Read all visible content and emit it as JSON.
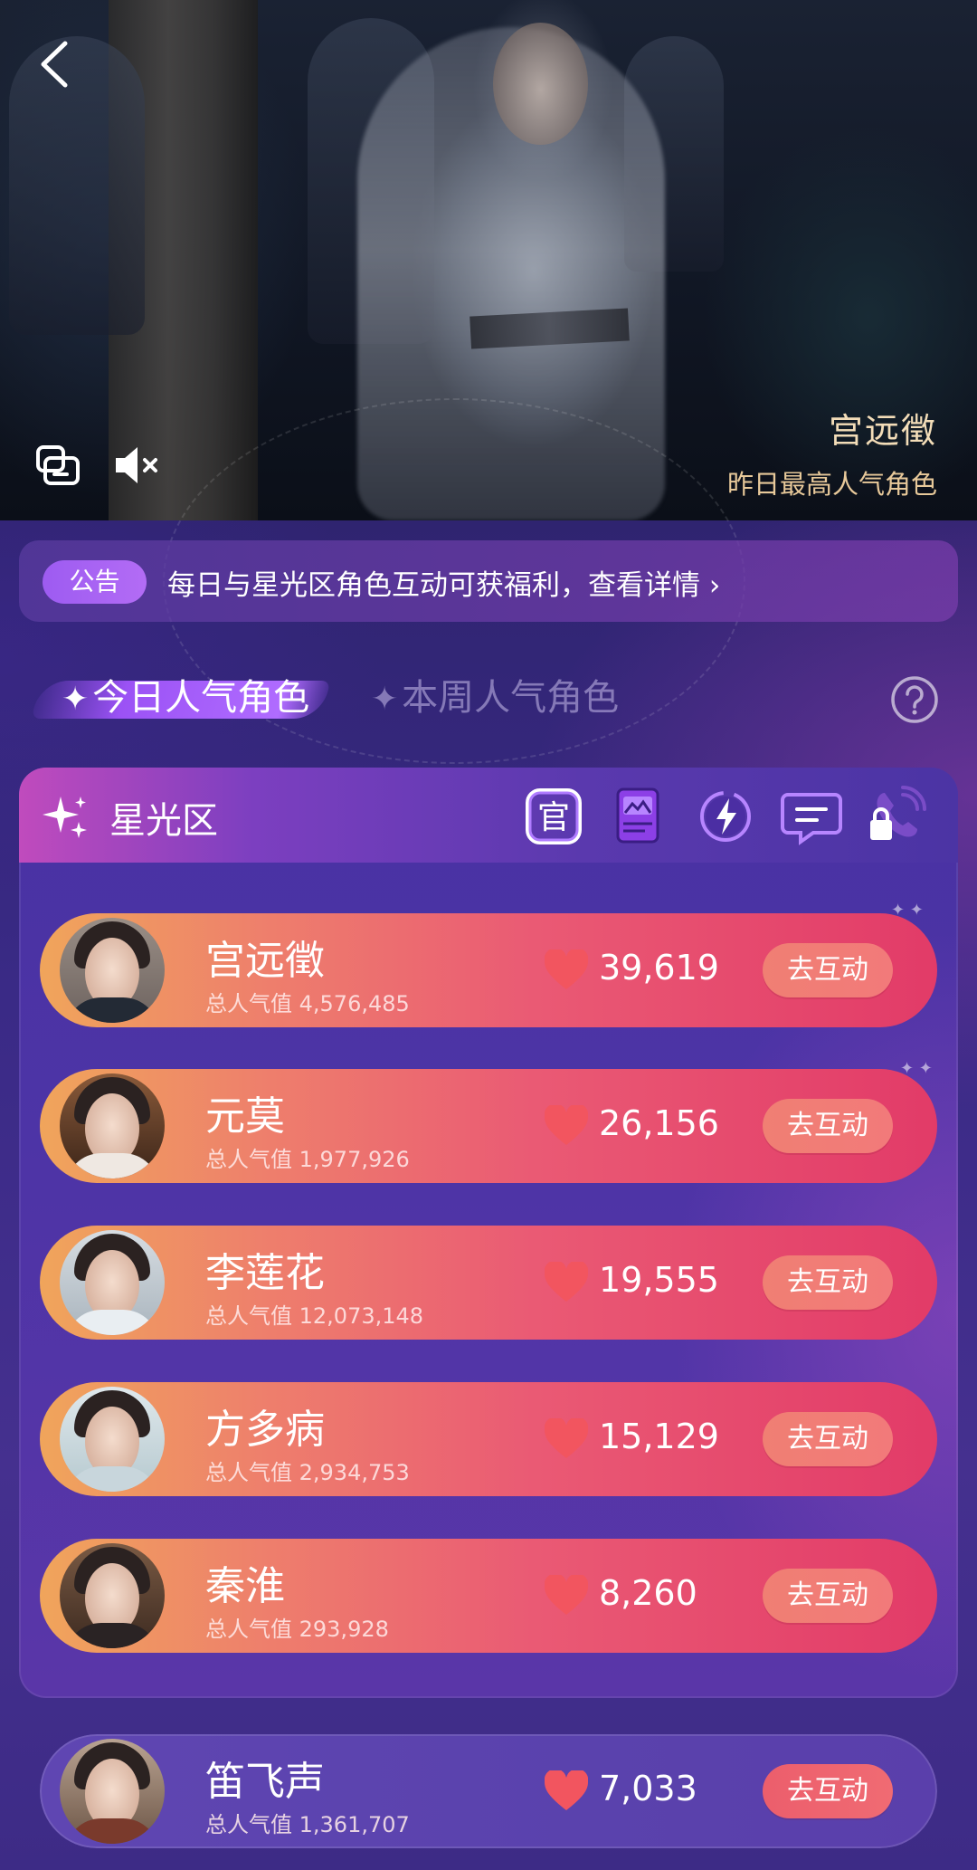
{
  "hero": {
    "character_name": "宫远徵",
    "subtitle": "昨日最高人气角色"
  },
  "notice": {
    "badge": "公告",
    "text": "每日与星光区角色互动可获福利，查看详情 ›"
  },
  "tabs": [
    {
      "label": "今日人气角色",
      "icon": "sparkle-icon",
      "active": true
    },
    {
      "label": "本周人气角色",
      "icon": "sparkle-icon",
      "active": false
    }
  ],
  "card": {
    "title": "星光区",
    "header_icons": [
      {
        "name": "official-icon",
        "label": "官"
      },
      {
        "name": "book-icon"
      },
      {
        "name": "lightning-timer-icon"
      },
      {
        "name": "chat-icon"
      },
      {
        "name": "phone-locked-icon"
      }
    ]
  },
  "ranking": [
    {
      "name": "宫远徵",
      "total": "总人气值 4,576,485",
      "score": "39,619",
      "button": "去互动"
    },
    {
      "name": "元莫",
      "total": "总人气值 1,977,926",
      "score": "26,156",
      "button": "去互动"
    },
    {
      "name": "李莲花",
      "total": "总人气值 12,073,148",
      "score": "19,555",
      "button": "去互动"
    },
    {
      "name": "方多病",
      "total": "总人气值 2,934,753",
      "score": "15,129",
      "button": "去互动"
    },
    {
      "name": "秦淮",
      "total": "总人气值 293,928",
      "score": "8,260",
      "button": "去互动"
    },
    {
      "name": "笛飞声",
      "total": "总人气值 1,361,707",
      "score": "7,033",
      "button": "去互动"
    }
  ],
  "colors": {
    "accent_purple": "#9d5bf1",
    "heart_red": "#f2555f",
    "gold_text": "#f3ddb8"
  }
}
